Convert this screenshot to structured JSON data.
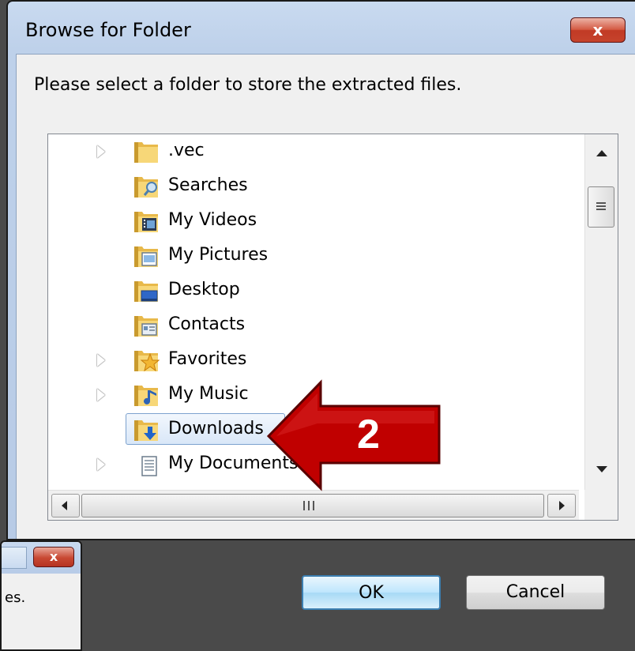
{
  "dialog": {
    "title": "Browse for Folder",
    "close_label": "x",
    "prompt": "Please select a folder to store the extracted files."
  },
  "folder_tree": {
    "items": [
      {
        "label": ".vec",
        "icon": "folder-icon",
        "expandable": true
      },
      {
        "label": "Searches",
        "icon": "searches-folder-icon",
        "expandable": false
      },
      {
        "label": "My Videos",
        "icon": "videos-folder-icon",
        "expandable": false
      },
      {
        "label": "My Pictures",
        "icon": "pictures-folder-icon",
        "expandable": false
      },
      {
        "label": "Desktop",
        "icon": "desktop-folder-icon",
        "expandable": false
      },
      {
        "label": "Contacts",
        "icon": "contacts-folder-icon",
        "expandable": false
      },
      {
        "label": "Favorites",
        "icon": "favorites-folder-icon",
        "expandable": true
      },
      {
        "label": "My Music",
        "icon": "music-folder-icon",
        "expandable": true
      },
      {
        "label": "Downloads",
        "icon": "downloads-folder-icon",
        "expandable": false,
        "selected": true
      },
      {
        "label": "My Documents",
        "icon": "documents-folder-icon",
        "expandable": true
      }
    ]
  },
  "buttons": {
    "ok_label": "OK",
    "cancel_label": "Cancel"
  },
  "annotation": {
    "step_number": "2",
    "color": "#c00000"
  },
  "background_window": {
    "close_label": "x",
    "text_fragment": "es."
  }
}
